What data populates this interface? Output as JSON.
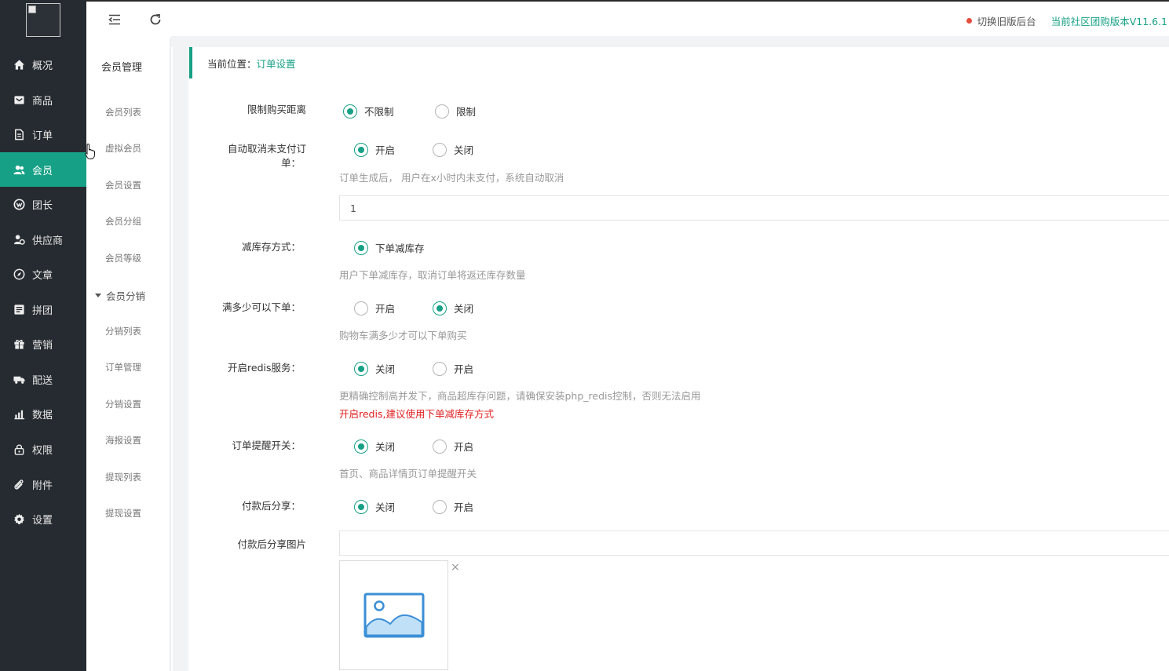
{
  "nav": {
    "items": [
      {
        "label": "概况",
        "icon": "home-icon"
      },
      {
        "label": "商品",
        "icon": "goods-icon"
      },
      {
        "label": "订单",
        "icon": "order-icon"
      },
      {
        "label": "会员",
        "icon": "members-icon"
      },
      {
        "label": "团长",
        "icon": "leader-icon"
      },
      {
        "label": "供应商",
        "icon": "supplier-icon"
      },
      {
        "label": "文章",
        "icon": "compass-icon"
      },
      {
        "label": "拼团",
        "icon": "group-buy-icon"
      },
      {
        "label": "营销",
        "icon": "gift-icon"
      },
      {
        "label": "配送",
        "icon": "truck-icon"
      },
      {
        "label": "数据",
        "icon": "bar-chart-icon"
      },
      {
        "label": "权限",
        "icon": "lock-icon"
      },
      {
        "label": "附件",
        "icon": "paperclip-icon"
      },
      {
        "label": "设置",
        "icon": "gear-icon"
      }
    ],
    "active": "会员"
  },
  "topbar": {
    "switch_old": "切换旧版后台",
    "version": "当前社区团购版本V11.6.1"
  },
  "subnav": {
    "title": "会员管理",
    "items": [
      "会员列表",
      "虚拟会员",
      "会员设置",
      "会员分组",
      "会员等级"
    ],
    "group": "会员分销",
    "group_items": [
      "分销列表",
      "订单管理",
      "分销设置",
      "海报设置",
      "提现列表",
      "提现设置"
    ]
  },
  "breadcrumb": {
    "prefix": "当前位置：",
    "current": "订单设置"
  },
  "form": {
    "limit_distance": {
      "label": "限制购买距离",
      "options": [
        "不限制",
        "限制"
      ],
      "selected": 0
    },
    "auto_cancel": {
      "label_line1": "自动取消未支付订",
      "label_line2": "单：",
      "options": [
        "开启",
        "关闭"
      ],
      "selected": 0,
      "help": "订单生成后， 用户在x小时内未支付，系统自动取消",
      "value": "1"
    },
    "stock_mode": {
      "label": "减库存方式：",
      "options": [
        "下单减库存"
      ],
      "selected": 0,
      "help": "用户下单减库存，取消订单将返还库存数量"
    },
    "min_amount": {
      "label": "满多少可以下单：",
      "options": [
        "开启",
        "关闭"
      ],
      "selected": 1,
      "help": "购物车满多少才可以下单购买"
    },
    "redis": {
      "label": "开启redis服务：",
      "options": [
        "关闭",
        "开启"
      ],
      "selected": 0,
      "help": "更精确控制高并发下，商品超库存问题，请确保安装php_redis控制，否则无法启用",
      "warn": "开启redis,建议使用下单减库存方式"
    },
    "order_remind": {
      "label": "订单提醒开关：",
      "options": [
        "关闭",
        "开启"
      ],
      "selected": 0,
      "help": "首页、商品详情页订单提醒开关"
    },
    "pay_share": {
      "label": "付款后分享：",
      "options": [
        "关闭",
        "开启"
      ],
      "selected": 0
    },
    "share_image": {
      "label": "付款后分享图片",
      "value": "",
      "remove": "×"
    }
  },
  "colors": {
    "accent": "#16a085",
    "nav_bg": "#252b30",
    "warn": "#e02020"
  }
}
